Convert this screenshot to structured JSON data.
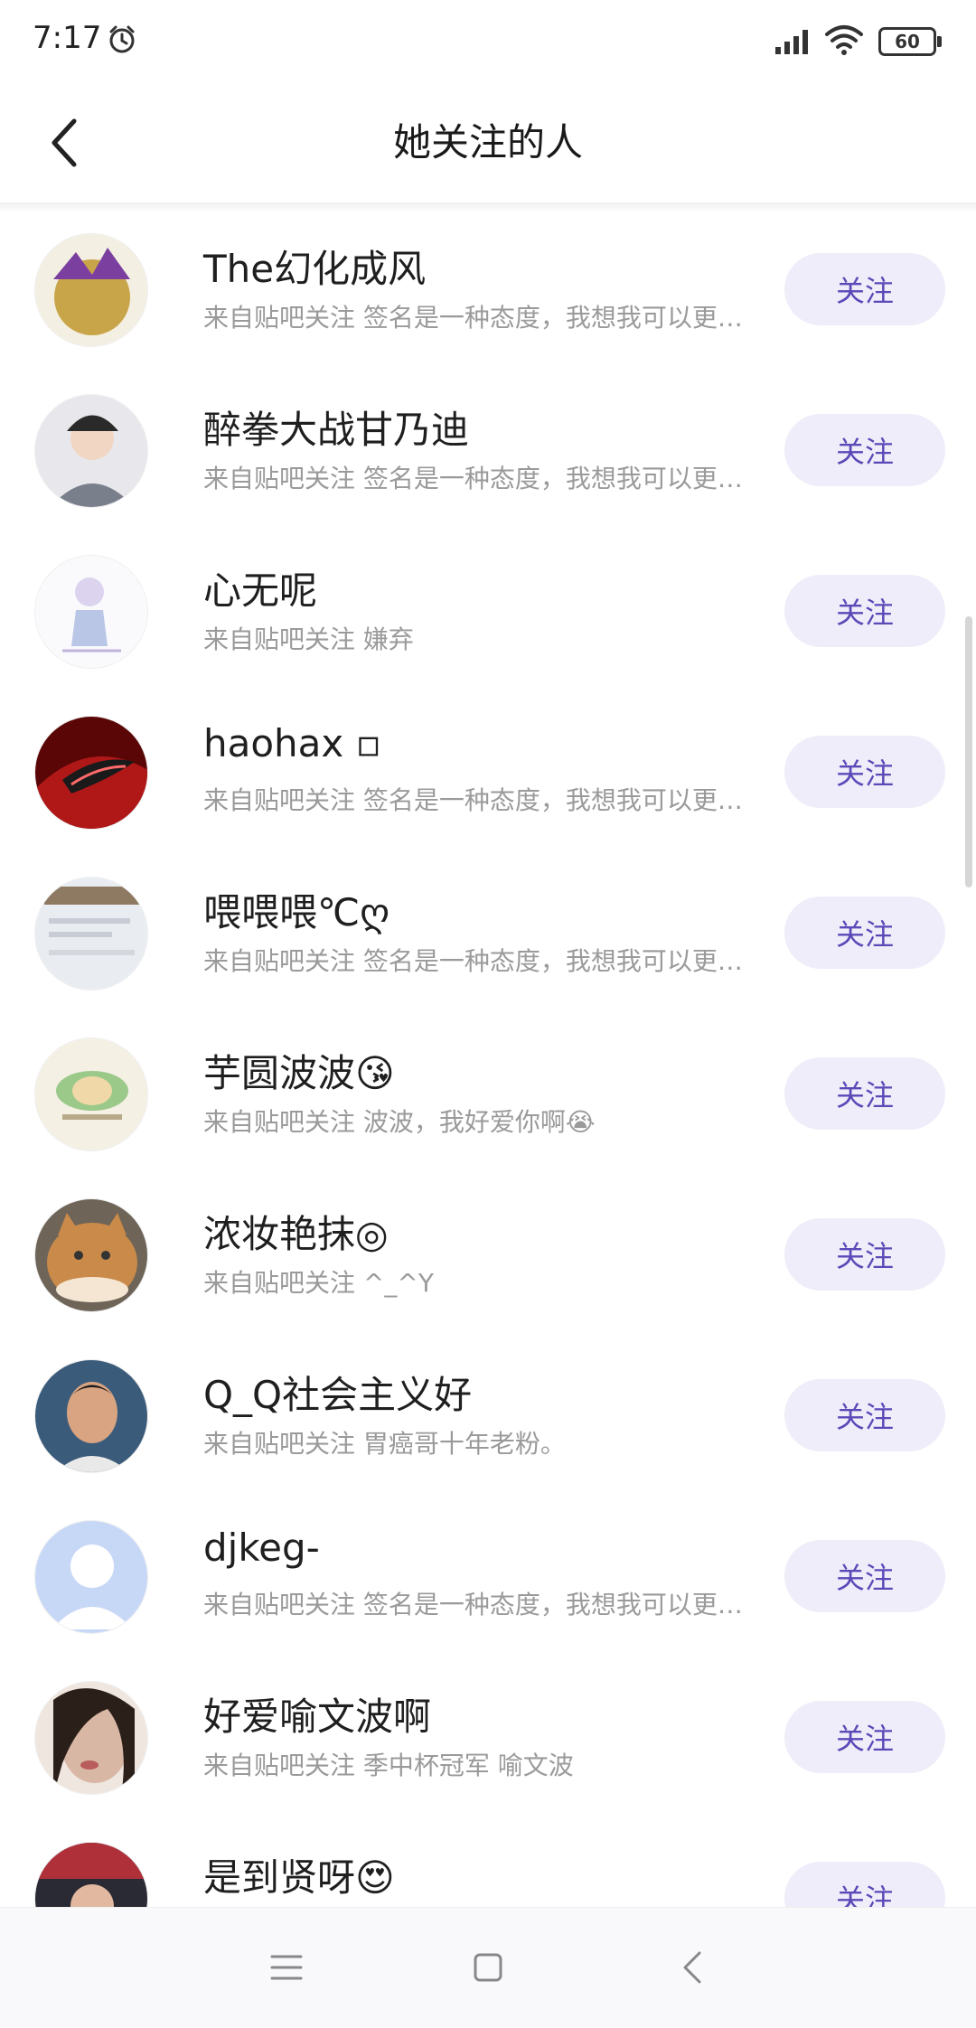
{
  "status_bar": {
    "time": "7:17",
    "battery": "60",
    "icons": [
      "alarm-icon",
      "signal-icon",
      "wifi-icon",
      "battery-icon"
    ]
  },
  "header": {
    "title": "她关注的人",
    "back_icon": "chevron-left-icon"
  },
  "users": [
    {
      "name": "The幻化成风",
      "sub": "来自贴吧关注 签名是一种态度，我想我可以更酷…",
      "button": "关注",
      "avatar_color": "#c9a54a"
    },
    {
      "name": "醉拳大战甘乃迪",
      "sub": "来自贴吧关注 签名是一种态度，我想我可以更酷…",
      "button": "关注",
      "avatar_color": "#7a7f8c"
    },
    {
      "name": "心无呢",
      "sub": "来自贴吧关注 嫌弃",
      "button": "关注",
      "avatar_color": "#dcd4ef"
    },
    {
      "name": "haohax ▫",
      "sub": "来自贴吧关注 签名是一种态度，我想我可以更酷…",
      "button": "关注",
      "avatar_color": "#b01818"
    },
    {
      "name": "喂喂喂℃ღ",
      "sub": "来自贴吧关注 签名是一种态度，我想我可以更酷…",
      "button": "关注",
      "avatar_color": "#e9ecf1"
    },
    {
      "name": "芋圆波波😘",
      "sub": "来自贴吧关注 波波，我好爱你啊😭",
      "button": "关注",
      "avatar_color": "#f4f0e4"
    },
    {
      "name": "浓妆艳抹◎",
      "sub": "来自贴吧关注 ^_^Y",
      "button": "关注",
      "avatar_color": "#c98a4a"
    },
    {
      "name": "Q_Q社会主义好",
      "sub": "来自贴吧关注 胃癌哥十年老粉。",
      "button": "关注",
      "avatar_color": "#3b5b7a"
    },
    {
      "name": "djkeg-",
      "sub": "来自贴吧关注 签名是一种态度，我想我可以更酷…",
      "button": "关注",
      "avatar_color": "#c7d8f7"
    },
    {
      "name": "好爱喻文波啊",
      "sub": "来自贴吧关注 季中杯冠军 喻文波",
      "button": "关注",
      "avatar_color": "#d8b7a4"
    },
    {
      "name": "是到贤呀😍",
      "sub": "",
      "button": "关注",
      "avatar_color": "#b0303a"
    }
  ],
  "nav_bar": {
    "icons": [
      "menu-icon",
      "home-square-icon",
      "back-triangle-icon"
    ]
  },
  "colors": {
    "accent": "#5b49b8",
    "button_bg": "#efedf9",
    "subtext": "#9a9a9a"
  }
}
